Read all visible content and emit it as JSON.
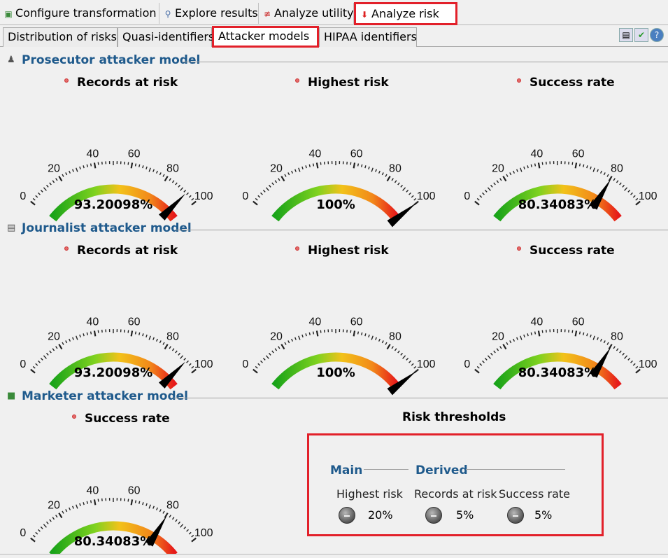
{
  "main_tabs": [
    {
      "label": "Configure transformation",
      "icon": "hierarchy-icon"
    },
    {
      "label": "Explore results",
      "icon": "magnifier-icon"
    },
    {
      "label": "Analyze utility",
      "icon": "chart-icon"
    },
    {
      "label": "Analyze risk",
      "icon": "risk-arrow-icon",
      "active": true
    }
  ],
  "sub_tabs": [
    {
      "label": "Distribution of risks"
    },
    {
      "label": "Quasi-identifiers"
    },
    {
      "label": "Attacker models",
      "active": true
    },
    {
      "label": "HIPAA identifiers"
    }
  ],
  "toolbar_icons": [
    "save-icon",
    "check-icon",
    "help-icon"
  ],
  "gauge_ticks": [
    "0",
    "20",
    "40",
    "60",
    "80",
    "100"
  ],
  "sections": {
    "prosecutor": {
      "title": "Prosecutor attacker model",
      "gauges": [
        {
          "label": "Records at risk",
          "value": 93.20098,
          "display": "93.20098%"
        },
        {
          "label": "Highest risk",
          "value": 100,
          "display": "100%"
        },
        {
          "label": "Success rate",
          "value": 80.34083,
          "display": "80.34083%"
        }
      ]
    },
    "journalist": {
      "title": "Journalist attacker model",
      "gauges": [
        {
          "label": "Records at risk",
          "value": 93.20098,
          "display": "93.20098%"
        },
        {
          "label": "Highest risk",
          "value": 100,
          "display": "100%"
        },
        {
          "label": "Success rate",
          "value": 80.34083,
          "display": "80.34083%"
        }
      ]
    },
    "marketer": {
      "title": "Marketer attacker model",
      "gauges": [
        {
          "label": "Success rate",
          "value": 80.34083,
          "display": "80.34083%"
        }
      ]
    }
  },
  "risk_thresholds": {
    "title": "Risk thresholds",
    "main_heading": "Main",
    "derived_heading": "Derived",
    "items": [
      {
        "label": "Highest risk",
        "value": "20%"
      },
      {
        "label": "Records at risk",
        "value": "5%"
      },
      {
        "label": "Success rate",
        "value": "5%"
      }
    ]
  }
}
